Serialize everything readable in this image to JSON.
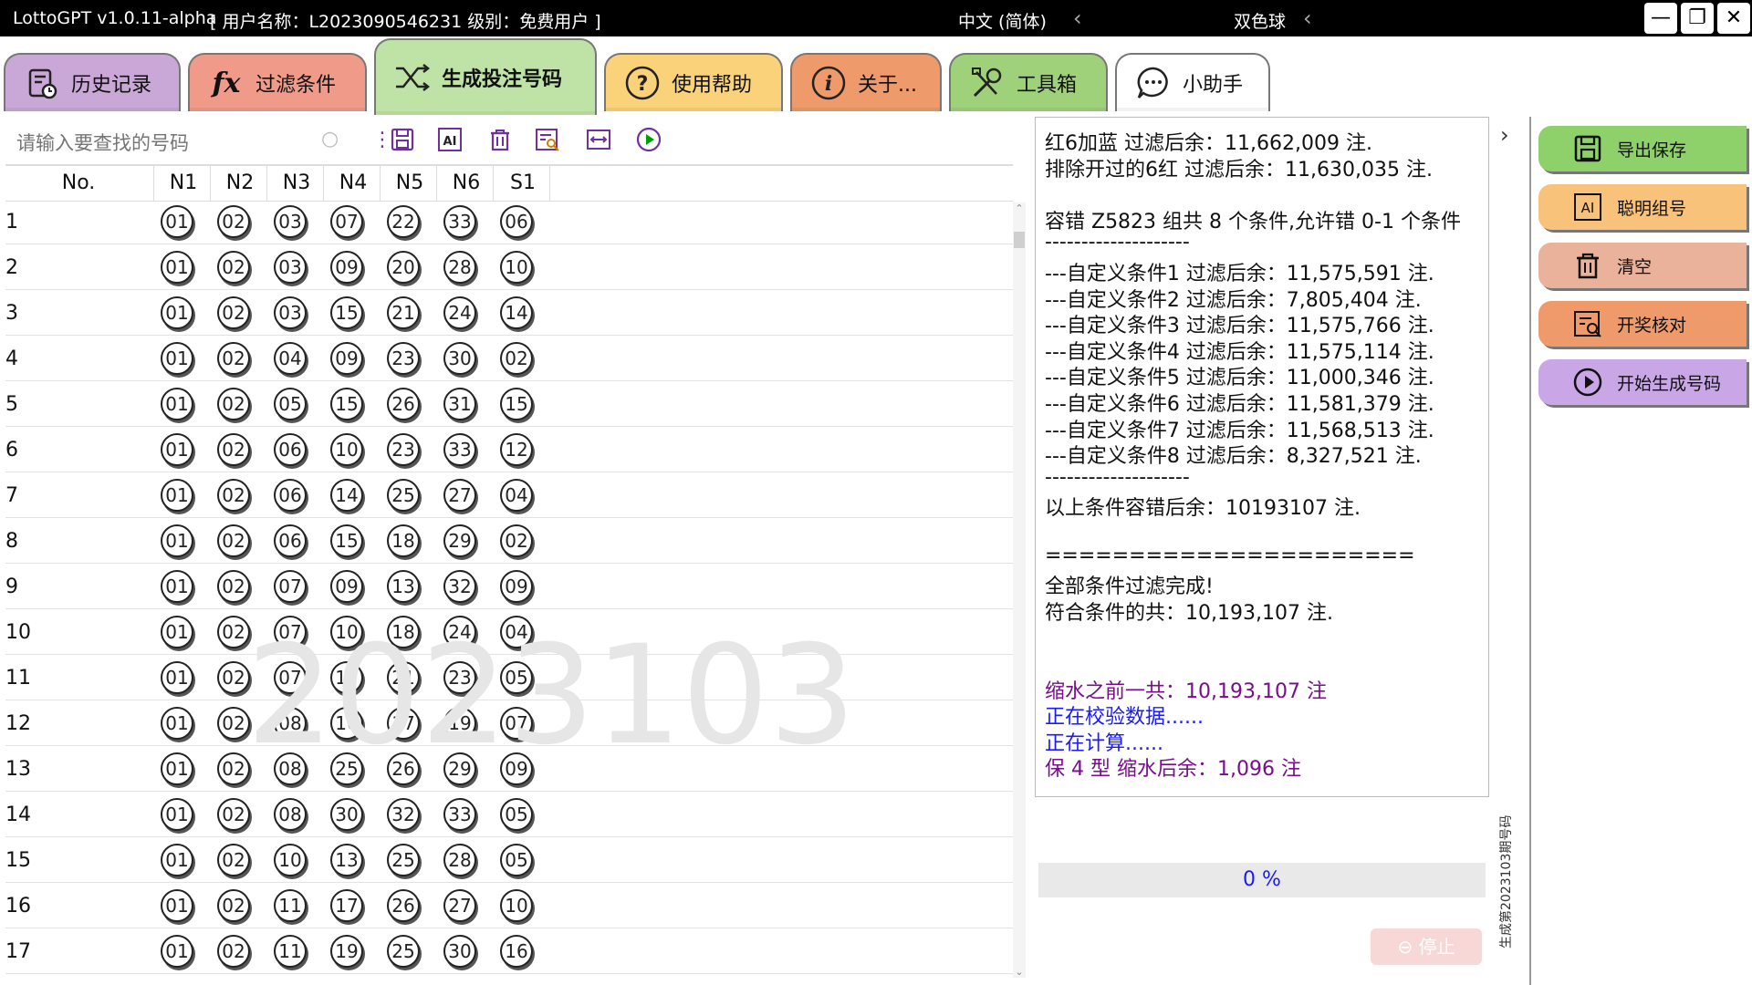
{
  "titlebar": {
    "app_name": "LottoGPT v1.0.11-alpha",
    "user_info": "[ 用户名称：L2023090546231  级别：免费用户 ]",
    "language": "中文 (简体)",
    "lottery": "双色球",
    "minimize": "—",
    "restore": "❐",
    "close": "✕"
  },
  "tabs": [
    {
      "label": "历史记录",
      "color": "#c9a7d6"
    },
    {
      "label": "过滤条件",
      "color": "#f09a8a"
    },
    {
      "label": "生成投注号码",
      "color": "#bfe3a6"
    },
    {
      "label": "使用帮助",
      "color": "#f9d27a"
    },
    {
      "label": "关于...",
      "color": "#ee9a6a"
    },
    {
      "label": "工具箱",
      "color": "#9fd07a"
    },
    {
      "label": "小助手",
      "color": "#ffffff"
    }
  ],
  "search": {
    "placeholder": "请输入要查找的号码"
  },
  "table": {
    "headers": [
      "No.",
      "N1",
      "N2",
      "N3",
      "N4",
      "N5",
      "N6",
      "S1"
    ],
    "rows": [
      [
        "1",
        "01",
        "02",
        "03",
        "07",
        "22",
        "33",
        "06"
      ],
      [
        "2",
        "01",
        "02",
        "03",
        "09",
        "20",
        "28",
        "10"
      ],
      [
        "3",
        "01",
        "02",
        "03",
        "15",
        "21",
        "24",
        "14"
      ],
      [
        "4",
        "01",
        "02",
        "04",
        "09",
        "23",
        "30",
        "02"
      ],
      [
        "5",
        "01",
        "02",
        "05",
        "15",
        "26",
        "31",
        "15"
      ],
      [
        "6",
        "01",
        "02",
        "06",
        "10",
        "23",
        "33",
        "12"
      ],
      [
        "7",
        "01",
        "02",
        "06",
        "14",
        "25",
        "27",
        "04"
      ],
      [
        "8",
        "01",
        "02",
        "06",
        "15",
        "18",
        "29",
        "02"
      ],
      [
        "9",
        "01",
        "02",
        "07",
        "09",
        "13",
        "32",
        "09"
      ],
      [
        "10",
        "01",
        "02",
        "07",
        "10",
        "18",
        "24",
        "04"
      ],
      [
        "11",
        "01",
        "02",
        "07",
        "17",
        "21",
        "23",
        "05"
      ],
      [
        "12",
        "01",
        "02",
        "08",
        "16",
        "17",
        "19",
        "07"
      ],
      [
        "13",
        "01",
        "02",
        "08",
        "25",
        "26",
        "29",
        "09"
      ],
      [
        "14",
        "01",
        "02",
        "08",
        "30",
        "32",
        "33",
        "05"
      ],
      [
        "15",
        "01",
        "02",
        "10",
        "13",
        "25",
        "28",
        "05"
      ],
      [
        "16",
        "01",
        "02",
        "11",
        "17",
        "26",
        "27",
        "10"
      ],
      [
        "17",
        "01",
        "02",
        "11",
        "19",
        "25",
        "30",
        "16"
      ]
    ]
  },
  "watermark": "2023103",
  "log": {
    "lines": [
      {
        "text": "红6加蓝 过滤后余：11,662,009 注.",
        "style": "normal"
      },
      {
        "text": "排除开过的6红 过滤后余：11,630,035 注.",
        "style": "normal"
      },
      {
        "text": "",
        "style": "normal"
      },
      {
        "text": "容错 Z5823 组共 8 个条件,允许错 0-1 个条件",
        "style": "normal"
      },
      {
        "text": "--------------------",
        "style": "normal"
      },
      {
        "text": "---自定义条件1 过滤后余：11,575,591 注.",
        "style": "normal"
      },
      {
        "text": "---自定义条件2 过滤后余：7,805,404 注.",
        "style": "normal"
      },
      {
        "text": "---自定义条件3 过滤后余：11,575,766 注.",
        "style": "normal"
      },
      {
        "text": "---自定义条件4 过滤后余：11,575,114 注.",
        "style": "normal"
      },
      {
        "text": "---自定义条件5 过滤后余：11,000,346 注.",
        "style": "normal"
      },
      {
        "text": "---自定义条件6 过滤后余：11,581,379 注.",
        "style": "normal"
      },
      {
        "text": "---自定义条件7 过滤后余：11,568,513 注.",
        "style": "normal"
      },
      {
        "text": "---自定义条件8 过滤后余：8,327,521 注.",
        "style": "normal"
      },
      {
        "text": "--------------------",
        "style": "normal"
      },
      {
        "text": "以上条件容错后余：10193107 注.",
        "style": "normal"
      },
      {
        "text": "",
        "style": "normal"
      },
      {
        "text": "======================",
        "style": "normal"
      },
      {
        "text": "全部条件过滤完成!",
        "style": "normal"
      },
      {
        "text": "符合条件的共：10,193,107 注.",
        "style": "normal"
      },
      {
        "text": "",
        "style": "normal"
      },
      {
        "text": "",
        "style": "normal"
      },
      {
        "text": "缩水之前一共：10,193,107 注",
        "style": "purple"
      },
      {
        "text": "正在校验数据......",
        "style": "blue"
      },
      {
        "text": "正在计算......",
        "style": "blue"
      },
      {
        "text": "保 4 型 缩水后余：1,096 注",
        "style": "purple"
      }
    ]
  },
  "progress": {
    "text": "0 %",
    "fraction": 0
  },
  "stop_button": {
    "label": "停止"
  },
  "side_label": "生成第2023103期号码",
  "right_buttons": [
    {
      "label": "导出保存",
      "color": "#8ed06a"
    },
    {
      "label": "聪明组号",
      "color": "#f8c27a"
    },
    {
      "label": "清空",
      "color": "#eab29a"
    },
    {
      "label": "开奖核对",
      "color": "#ee9a6a"
    },
    {
      "label": "开始生成号码",
      "color": "#c9a7e6"
    }
  ]
}
